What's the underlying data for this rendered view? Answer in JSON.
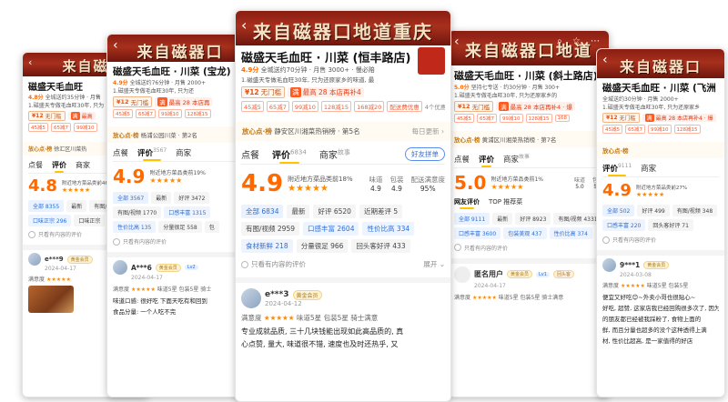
{
  "cards": [
    {
      "id": "c1",
      "banner": "来自磁",
      "title": "磁盛天毛血旺",
      "meta": {
        "score": "4.8分",
        "rest": "全城送约35分钟 · 月售"
      },
      "intro": "1.磁盛天专做毛血旺30年, 只为",
      "coupon": {
        "amount": "¥12",
        "label": "无门槛"
      },
      "promo": {
        "tag": "满",
        "text": "最高"
      },
      "pills": [
        "45减5",
        "65减7",
        "99减10"
      ],
      "rank": {
        "label": "放心点·榜",
        "text": "徐汇区川菜热",
        "go": ""
      },
      "tabs": [
        "点餐",
        "评价",
        "商家"
      ],
      "score": "4.8",
      "near": "附近地方菜品类前46%",
      "chips": [
        "全部 8355",
        "最新",
        "有图/视频 3978",
        "口味正宗 296",
        "口味正宗"
      ],
      "only": "只看有内容的评价",
      "review": {
        "user": "e***9",
        "badge": "黄金会员",
        "date": "2024-04-17",
        "scoreline": "满意度"
      }
    },
    {
      "id": "c2",
      "banner": "来自磁器口",
      "title": "磁盛天毛血旺 · 川菜 (宝龙)",
      "meta": {
        "score": "4.9分",
        "rest": "全城送约76分钟 · 月售 2000+"
      },
      "intro": "1.磁盛天专做毛血旺30年, 只为还",
      "coupon": {
        "amount": "¥12",
        "label": "无门槛"
      },
      "promo": {
        "tag": "满",
        "text": "最高 28 本店再"
      },
      "pills": [
        "45减5",
        "65减7",
        "99减10",
        "128减15"
      ],
      "rank": {
        "label": "放心点·榜",
        "text": "杨浦公园川菜 · 第2名",
        "go": ""
      },
      "tabs": [
        "点餐",
        "评价",
        "商家"
      ],
      "tabcount": "3567",
      "score": "4.9",
      "near": "附近地方菜品类前19%",
      "chips": [
        "全部 3567",
        "最新",
        "好评 3472",
        "有图/视频 1770",
        "口感丰富 1315",
        "性价比高 135",
        "分量很足 558",
        "包"
      ],
      "only": "只看有内容的评价",
      "review": {
        "user": "A***6",
        "badge": "黄金会员",
        "lv": "Lv2",
        "date": "2024-04-17",
        "scoreline": "满意度",
        "s1": "味道5星",
        "s2": "包装5星",
        "s3": "骑士",
        "text1": "味道口感: 很好吃 下面天吃有和回到",
        "text2": "食品分量: 一个人吃不完"
      }
    },
    {
      "id": "c3",
      "banner": "来自磁器口地道重庆",
      "title": "磁盛天毛血旺 · 川菜 (恒丰路店)",
      "meta": {
        "score": "4.9分",
        "rest": "全城送约70分钟 · 月售 3000+ · 慢必赔"
      },
      "intro": "1.磁盛天专做毛血旺30年, 只为还原家乡的味道, 最",
      "coupon": {
        "amount": "¥12",
        "label": "无门槛"
      },
      "promo": {
        "tag": "满",
        "text": "最高 28 本店再补4"
      },
      "pills": [
        "45减5",
        "65减7",
        "99减10",
        "128减15",
        "168减20",
        "配送费优惠"
      ],
      "moreoffers": "4个优惠",
      "rank": {
        "label": "放心点·榜",
        "text": "静安区川湘菜热销榜 · 第5名",
        "go": "每日更新"
      },
      "tabs": [
        "点餐",
        "评价",
        "商家"
      ],
      "tabcount": "6834",
      "tab3suffix": "故事",
      "share": "好友拼单",
      "score": "4.9",
      "near": "附近地方菜品类前18%",
      "subs": [
        {
          "k": "味道",
          "v": "4.9"
        },
        {
          "k": "包装",
          "v": "4.9"
        },
        {
          "k": "配送满意度",
          "v": "95%"
        }
      ],
      "chips": [
        "全部 6834",
        "最新",
        "好评 6520",
        "近期差评 5",
        "有图/视频 2959",
        "口感丰富 2604",
        "性价比高 334",
        "食材新鲜 218",
        "分量很足 966",
        "回头客好评 433"
      ],
      "only": "只看有内容的评价",
      "expand": "展开",
      "review": {
        "user": "e***3",
        "badge": "黄金会员",
        "date": "2024-04-12",
        "scoreline": "满意度",
        "s1": "味道5星",
        "s2": "包装5星",
        "s3": "骑士满意",
        "text1": "专业成就品质, 三十几块钱能出现如此高品质的, 真",
        "text2": "心点赞, 量大, 味道很不错, 速度也及时还热乎, 又"
      }
    },
    {
      "id": "c4",
      "banner": "来自磁器口地道",
      "title": "磁盛天毛血旺 · 川菜 (斜土路店)",
      "meta": {
        "score": "5.0分",
        "rest": "坚持七专送 · 约30分钟 · 月售 300+"
      },
      "intro": "1.磁盛天专做毛血旺30年, 只为还原家乡的",
      "coupon": {
        "amount": "¥12",
        "label": "无门槛"
      },
      "promo": {
        "tag": "满",
        "text": "最高 28 本店再补4 · 爆"
      },
      "pills": [
        "45减5",
        "65减7",
        "99减10",
        "128减15",
        "168"
      ],
      "rank": {
        "label": "放心点·榜",
        "text": "黄浦区川湘菜热销榜 · 第7名",
        "go": ""
      },
      "tabs": [
        "点餐",
        "评价",
        "商家"
      ],
      "tab3suffix": "故事",
      "score": "5.0",
      "near": "附近地方菜品类前1%",
      "subs": [
        {
          "k": "味道",
          "v": "5.0"
        },
        {
          "k": "包装",
          "v": "5.0"
        }
      ],
      "subtabs": [
        "网友评价",
        "TOP 推荐菜"
      ],
      "chips": [
        "全部 9111",
        "最新",
        "好评 8923",
        "有图/视频 4331",
        "口感丰富 3600",
        "包装美观 437",
        "性价比高 374"
      ],
      "only": "只看有内容的评价",
      "review": {
        "user": "匿名用户",
        "badge": "黄金会员",
        "lv": "Lv1",
        "extra": "回头客",
        "date": "2024-04-17",
        "scoreline": "满意度",
        "s1": "味道5星",
        "s2": "包装5星",
        "s3": "骑士满意"
      }
    },
    {
      "id": "c5",
      "banner": "来自磁器口",
      "title": "磁盛天毛血旺 · 川菜 (飞洲",
      "meta": {
        "score": "",
        "rest": "全城送约30分钟 · 月售 2000+"
      },
      "intro": "1.磁盛天专做毛血旺30年, 只为还原家乡",
      "coupon": {
        "amount": "¥12",
        "label": "无门槛"
      },
      "promo": {
        "tag": "满",
        "text": "最高 28 本店再补4 · 爆"
      },
      "pills": [
        "45减5",
        "65减7",
        "99减10",
        "128减15"
      ],
      "rank": {
        "label": "放心点·榜",
        "text": "",
        "go": ""
      },
      "tabs": [
        "评价",
        "商家"
      ],
      "tabcount": "9111",
      "score": "4.9",
      "near": "附近地方菜品类前27%",
      "chips": [
        "全部 502",
        "好评 499",
        "有图/视频 348",
        "口感丰富 220",
        "回头客好评 71"
      ],
      "only": "只看有内容的评价",
      "review": {
        "user": "9***1",
        "badge": "黄金会员",
        "date": "2024-03-08",
        "scoreline": "满意度",
        "s1": "味道5星",
        "s2": "包装5星",
        "text1": "便宜又好吃😊~外卖小哥也很贴心~",
        "text2": "好吃, 超赞, 这家店我已经回购很多次了, 因为",
        "text3": "的朋友都已经被我踩粉了, 食物上面的",
        "text4": "鲜, 而且分量也超多的没个这种透得上满",
        "text5": "材, 性价比超高, 是一家值得的好店"
      }
    }
  ]
}
